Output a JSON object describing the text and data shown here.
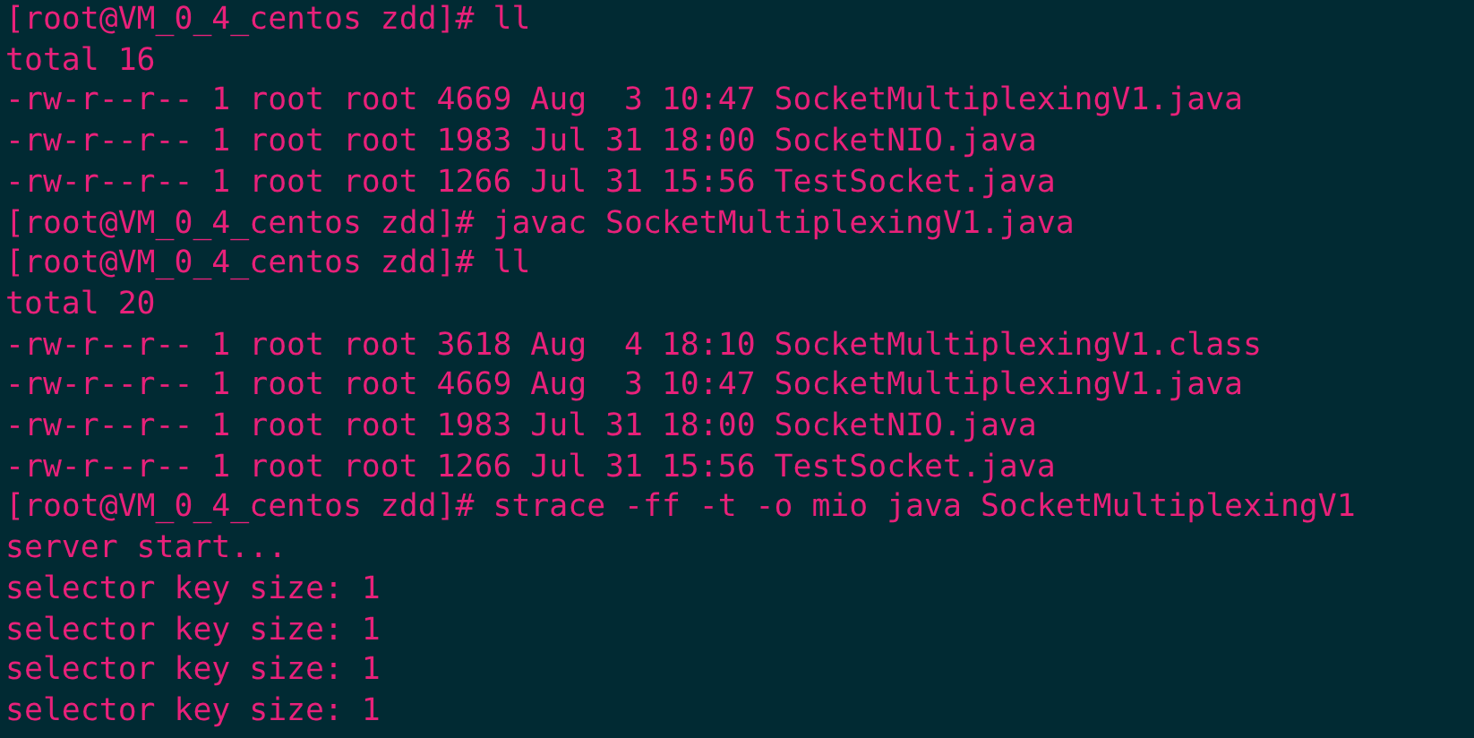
{
  "terminal": {
    "lines": [
      "[root@VM_0_4_centos zdd]# ll",
      "total 16",
      "-rw-r--r-- 1 root root 4669 Aug  3 10:47 SocketMultiplexingV1.java",
      "-rw-r--r-- 1 root root 1983 Jul 31 18:00 SocketNIO.java",
      "-rw-r--r-- 1 root root 1266 Jul 31 15:56 TestSocket.java",
      "[root@VM_0_4_centos zdd]# javac SocketMultiplexingV1.java",
      "[root@VM_0_4_centos zdd]# ll",
      "total 20",
      "-rw-r--r-- 1 root root 3618 Aug  4 18:10 SocketMultiplexingV1.class",
      "-rw-r--r-- 1 root root 4669 Aug  3 10:47 SocketMultiplexingV1.java",
      "-rw-r--r-- 1 root root 1983 Jul 31 18:00 SocketNIO.java",
      "-rw-r--r-- 1 root root 1266 Jul 31 15:56 TestSocket.java",
      "[root@VM_0_4_centos zdd]# strace -ff -t -o mio java SocketMultiplexingV1",
      "server start...",
      "selector key size: 1",
      "selector key size: 1",
      "selector key size: 1",
      "selector key size: 1"
    ]
  }
}
